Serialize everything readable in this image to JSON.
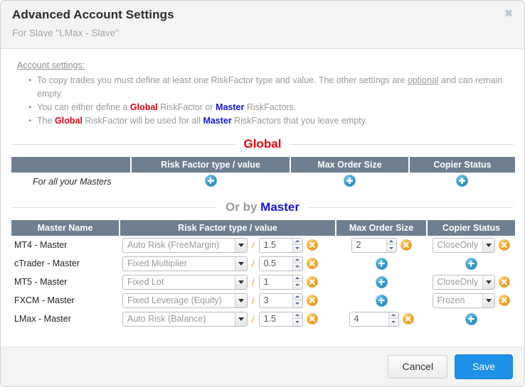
{
  "header": {
    "title": "Advanced Account Settings",
    "subtitle": "For Slave \"LMax - Slave\"",
    "close_label": "✖"
  },
  "notes": {
    "title": "Account settings:",
    "items": [
      {
        "parts": [
          {
            "t": "To copy trades you must define at least one RiskFactor type and value. The other settings are ",
            "s": "plain"
          },
          {
            "t": "optional",
            "s": "underline"
          },
          {
            "t": " and can remain empty.",
            "s": "plain"
          }
        ]
      },
      {
        "parts": [
          {
            "t": "You can either define a ",
            "s": "plain"
          },
          {
            "t": "Global",
            "s": "global"
          },
          {
            "t": " RiskFactor or ",
            "s": "plain"
          },
          {
            "t": "Master",
            "s": "master"
          },
          {
            "t": " RiskFactors.",
            "s": "plain"
          }
        ]
      },
      {
        "parts": [
          {
            "t": "The ",
            "s": "plain"
          },
          {
            "t": "Global",
            "s": "global"
          },
          {
            "t": " RiskFactor will be used for all ",
            "s": "plain"
          },
          {
            "t": "Master",
            "s": "master"
          },
          {
            "t": " RiskFactors that you leave empty.",
            "s": "plain"
          }
        ]
      }
    ]
  },
  "global_section": {
    "divider_title": "Global",
    "columns": [
      "",
      "Risk Factor type / value",
      "Max Order Size",
      "Copier Status"
    ],
    "row_label": "For all your Masters",
    "risk_factor_action": "add",
    "max_order_size_action": "add",
    "copier_status_action": "add"
  },
  "master_section": {
    "divider_title_prefix": "Or by ",
    "divider_title_accent": "Master",
    "columns": [
      "Master Name",
      "Risk Factor type / value",
      "Max Order Size",
      "Copier Status"
    ],
    "rows": [
      {
        "name": "MT4 - Master",
        "risk_factor_type": "Auto Risk (FreeMargin)",
        "risk_factor_value": "1.5",
        "risk_factor_action": "remove",
        "max_order_size_value": "2",
        "max_order_size_action": "remove",
        "copier_status_value": "CloseOnly",
        "copier_status_action": "remove"
      },
      {
        "name": "cTrader - Master",
        "risk_factor_type": "Fixed Multiplier",
        "risk_factor_value": "0.5",
        "risk_factor_action": "remove",
        "max_order_size_value": null,
        "max_order_size_action": "add",
        "copier_status_value": null,
        "copier_status_action": "add"
      },
      {
        "name": "MT5 - Master",
        "risk_factor_type": "Fixed Lot",
        "risk_factor_value": "1",
        "risk_factor_action": "remove",
        "max_order_size_value": null,
        "max_order_size_action": "add",
        "copier_status_value": "CloseOnly",
        "copier_status_action": "remove"
      },
      {
        "name": "FXCM - Master",
        "risk_factor_type": "Fixed Leverage (Equity)",
        "risk_factor_value": "3",
        "risk_factor_action": "remove",
        "max_order_size_value": null,
        "max_order_size_action": "add",
        "copier_status_value": "Frozen",
        "copier_status_action": "remove"
      },
      {
        "name": "LMax - Master",
        "risk_factor_type": "Auto Risk (Balance)",
        "risk_factor_value": "1.5",
        "risk_factor_action": "remove",
        "max_order_size_value": "4",
        "max_order_size_action": "remove",
        "copier_status_value": null,
        "copier_status_action": "add"
      }
    ],
    "separator": "/"
  },
  "footer": {
    "cancel_label": "Cancel",
    "save_label": "Save"
  },
  "colors": {
    "header_bg": "#6d7f90",
    "accent_red": "#e8000d",
    "accent_blue": "#1414e0",
    "save_blue": "#1e90e8",
    "icon_add": "#2f93c9",
    "icon_remove": "#f0a023"
  }
}
